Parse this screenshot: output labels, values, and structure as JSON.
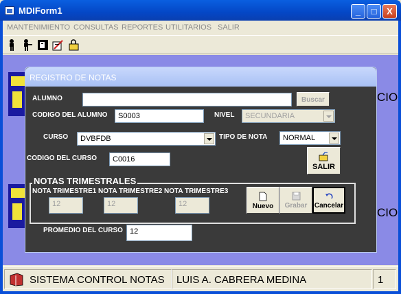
{
  "window": {
    "title": "MDIForm1",
    "buttons": [
      "_",
      "□",
      "X"
    ]
  },
  "menubar": {
    "items": [
      "MANTENIMIENTO",
      "CONSULTAS",
      "REPORTES",
      "UTILITARIOS",
      "SALIR"
    ]
  },
  "toolbar": {
    "icons": [
      "person-icon",
      "users-icon",
      "document-icon",
      "edit-icon",
      "lock-icon"
    ]
  },
  "background_form": {
    "text_fragment": "CIO"
  },
  "form": {
    "title": "REGISTRO DE NOTAS",
    "alumno": {
      "label": "ALUMNO",
      "value": ""
    },
    "buscar_label": "Buscar",
    "codigo_alumno": {
      "label": "CODIGO DEL ALUMNO",
      "value": "S0003"
    },
    "nivel": {
      "label": "NIVEL",
      "value": "SECUNDARIA"
    },
    "curso": {
      "label": "CURSO",
      "value": "DVBFDB"
    },
    "tipo_nota": {
      "label": "TIPO DE NOTA",
      "value": "NORMAL"
    },
    "codigo_curso": {
      "label": "CODIGO DEL CURSO",
      "value": "C0016"
    },
    "salir_label": "SALIR",
    "notas": {
      "group_title": "NOTAS TRIMESTRALES",
      "t1": {
        "label": "NOTA TRIMESTRE1",
        "value": "12"
      },
      "t2": {
        "label": "NOTA TRIMESTRE2",
        "value": "12"
      },
      "t3": {
        "label": "NOTA TRIMESTRE3",
        "value": "12"
      }
    },
    "nuevo_label": "Nuevo",
    "grabar_label": "Grabar",
    "cancelar_label": "Cancelar",
    "promedio": {
      "label": "PROMEDIO DEL CURSO",
      "value": "12"
    }
  },
  "statusbar": {
    "system": "SISTEMA CONTROL NOTAS",
    "user": "LUIS A. CABRERA MEDINA",
    "number": "1"
  }
}
